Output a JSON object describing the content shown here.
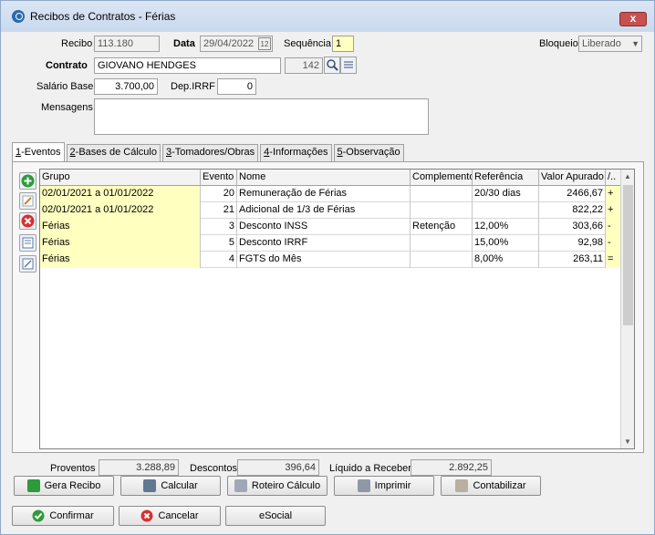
{
  "window": {
    "title": "Recibos de Contratos - Férias",
    "close": "x"
  },
  "header": {
    "recibo_label": "Recibo",
    "recibo_value": "113.180",
    "data_label": "Data",
    "data_value": "29/04/2022",
    "calendar_label": "12",
    "sequencia_label": "Sequência",
    "sequencia_value": "1",
    "bloqueio_label": "Bloqueio",
    "bloqueio_value": "Liberado",
    "contrato_label": "Contrato",
    "contrato_value": "GIOVANO HENDGES",
    "contrato_code": "142",
    "salario_label": "Salário Base",
    "salario_value": "3.700,00",
    "dep_label": "Dep.IRRF",
    "dep_value": "0",
    "mensagens_label": "Mensagens",
    "mensagens_value": ""
  },
  "tabs": [
    {
      "key": "1",
      "label": "-Eventos"
    },
    {
      "key": "2",
      "label": "-Bases de Cálculo"
    },
    {
      "key": "3",
      "label": "-Tomadores/Obras"
    },
    {
      "key": "4",
      "label": "-Informações"
    },
    {
      "key": "5",
      "label": "-Observação"
    }
  ],
  "grid": {
    "columns": [
      "Grupo",
      "Evento",
      "Nome",
      "Complemento",
      "Referência",
      "Valor Apurado",
      "/.."
    ],
    "rows": [
      {
        "grupo": "02/01/2021 a 01/01/2022",
        "evento": "20",
        "nome": "Remuneração de Férias",
        "complemento": "",
        "referencia": "20/30 dias",
        "valor": "2466,67",
        "sinal": "+"
      },
      {
        "grupo": "02/01/2021 a 01/01/2022",
        "evento": "21",
        "nome": "Adicional de 1/3 de Férias",
        "complemento": "",
        "referencia": "",
        "valor": "822,22",
        "sinal": "+"
      },
      {
        "grupo": "Férias",
        "evento": "3",
        "nome": "Desconto INSS",
        "complemento": "Retenção",
        "referencia": "12,00%",
        "valor": "303,66",
        "sinal": "-"
      },
      {
        "grupo": "Férias",
        "evento": "5",
        "nome": "Desconto IRRF",
        "complemento": "",
        "referencia": "15,00%",
        "valor": "92,98",
        "sinal": "-"
      },
      {
        "grupo": "Férias",
        "evento": "4",
        "nome": "FGTS do Mês",
        "complemento": "",
        "referencia": "8,00%",
        "valor": "263,11",
        "sinal": "="
      }
    ]
  },
  "totals": {
    "proventos_label": "Proventos",
    "proventos_value": "3.288,89",
    "descontos_label": "Descontos",
    "descontos_value": "396,64",
    "liquido_label": "Líquido a Receber",
    "liquido_value": "2.892,25"
  },
  "buttons": {
    "gera_recibo": "Gera Recibo",
    "calcular": "Calcular",
    "roteiro": "Roteiro Cálculo",
    "imprimir": "Imprimir",
    "contabilizar": "Contabilizar",
    "confirmar": "Confirmar",
    "cancelar": "Cancelar",
    "esocial": "eSocial"
  },
  "colors": {
    "accent_yellow": "#ffffc0",
    "title_bg": "#c9d9ee",
    "close_red": "#c75050"
  }
}
